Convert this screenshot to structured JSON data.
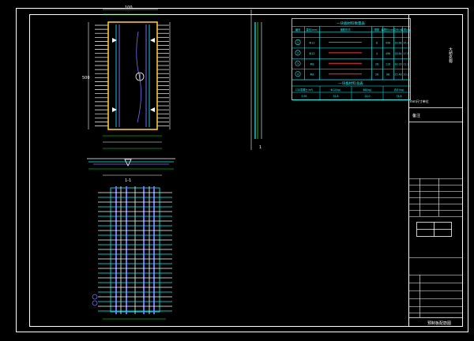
{
  "drawing": {
    "title_block": {
      "side_title": "大桥名称",
      "drawing_title": "预制板配筋图",
      "header_label": "备注",
      "sheet_code": "FN-2",
      "note": "mm尺寸单位"
    },
    "rebar_table": {
      "title": "一块板材料数量表",
      "header": [
        "编号",
        "直径(mm)",
        "钢筋形式",
        "根数",
        "每根长(cm)",
        "共长(m)",
        "共重(kg)"
      ],
      "subheader": [
        "",
        "",
        "",
        "",
        "",
        "",
        ""
      ],
      "rows": [
        {
          "id": "1",
          "dia": "Φ12",
          "n": "8",
          "len": "496",
          "total": "39.68",
          "wt": "35.2"
        },
        {
          "id": "2",
          "dia": "Φ12",
          "n": "4",
          "len": "496",
          "total": "19.84",
          "wt": "17.6"
        },
        {
          "id": "3",
          "dia": "Φ8",
          "n": "26",
          "len": "116",
          "total": "30.16",
          "wt": "11.9"
        },
        {
          "id": "4",
          "dia": "Φ8",
          "n": "26",
          "len": "98",
          "total": "25.48",
          "wt": "10.1"
        }
      ],
      "summary_title": "一块板材料总表",
      "summary_header": [
        "C30混凝土(m³)",
        "Φ12(kg)",
        "Φ8(kg)",
        "合计(kg)"
      ],
      "summary_values": [
        "0.95",
        "52.8",
        "22.0",
        "74.8"
      ]
    },
    "annotations": {
      "plan_width": "100",
      "plan_length": "500",
      "section_label": "1-1",
      "marker": "1"
    }
  }
}
